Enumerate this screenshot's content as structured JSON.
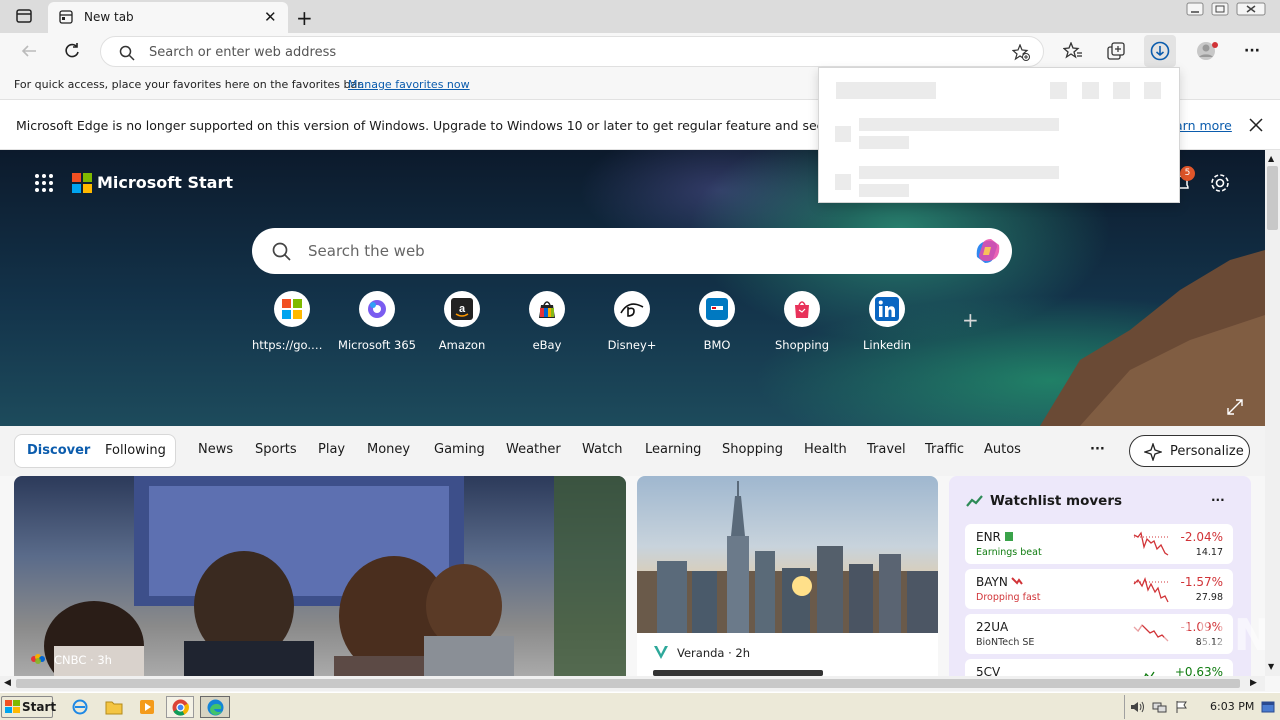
{
  "browser": {
    "tab": {
      "title": "New tab"
    },
    "address": {
      "placeholder": "Search or enter web address"
    },
    "favorites_bar": {
      "message": "For quick access, place your favorites here on the favorites bar.",
      "link": "Manage favorites now"
    },
    "info_bar": {
      "message": "Microsoft Edge is no longer supported on this version of Windows. Upgrade to Windows 10 or later to get regular feature and security u",
      "learn_more": "arn more"
    }
  },
  "start_page": {
    "brand": "Microsoft Start",
    "notification_count": "5",
    "search_placeholder": "Search the web",
    "quick_links": [
      {
        "label": "https://go.m...",
        "icon": "microsoft-logo-icon"
      },
      {
        "label": "Microsoft 365",
        "icon": "microsoft-365-icon"
      },
      {
        "label": "Amazon",
        "icon": "amazon-icon"
      },
      {
        "label": "eBay",
        "icon": "ebay-icon"
      },
      {
        "label": "Disney+",
        "icon": "disney-plus-icon"
      },
      {
        "label": "BMO",
        "icon": "bmo-icon"
      },
      {
        "label": "Shopping",
        "icon": "shopping-bag-icon"
      },
      {
        "label": "Linkedin",
        "icon": "linkedin-icon"
      }
    ],
    "feed_tabs": {
      "discover": "Discover",
      "following": "Following"
    },
    "categories": [
      "News",
      "Sports",
      "Play",
      "Money",
      "Gaming",
      "Weather",
      "Watch",
      "Learning",
      "Shopping",
      "Health",
      "Travel",
      "Traffic",
      "Autos"
    ],
    "more": "···",
    "personalize": "Personalize",
    "main_card": {
      "source": "CNBC · 3h"
    },
    "mid_card": {
      "source": "Veranda · 2h"
    },
    "watchlist": {
      "title": "Watchlist movers",
      "more": "···",
      "rows": [
        {
          "symbol": "ENR",
          "subtitle": "Earnings beat",
          "change": "-2.04%",
          "price": "14.17",
          "subtitle_color": "#107c10"
        },
        {
          "symbol": "BAYN",
          "subtitle": "Dropping fast",
          "change": "-1.57%",
          "price": "27.98",
          "subtitle_color": "#d13438"
        },
        {
          "symbol": "22UA",
          "subtitle": "BioNTech SE",
          "change": "-1.09%",
          "price": "85.12",
          "subtitle_color": "#333333"
        },
        {
          "symbol": "5CV",
          "subtitle": "",
          "change": "+0.63%",
          "price": "",
          "subtitle_color": "#333333"
        }
      ]
    }
  },
  "taskbar": {
    "start": "Start",
    "clock": "6:03 PM"
  },
  "watermark": "ANY.RUN",
  "colors": {
    "accent": "#0b5cad",
    "negative": "#d13438",
    "positive": "#107c10"
  }
}
